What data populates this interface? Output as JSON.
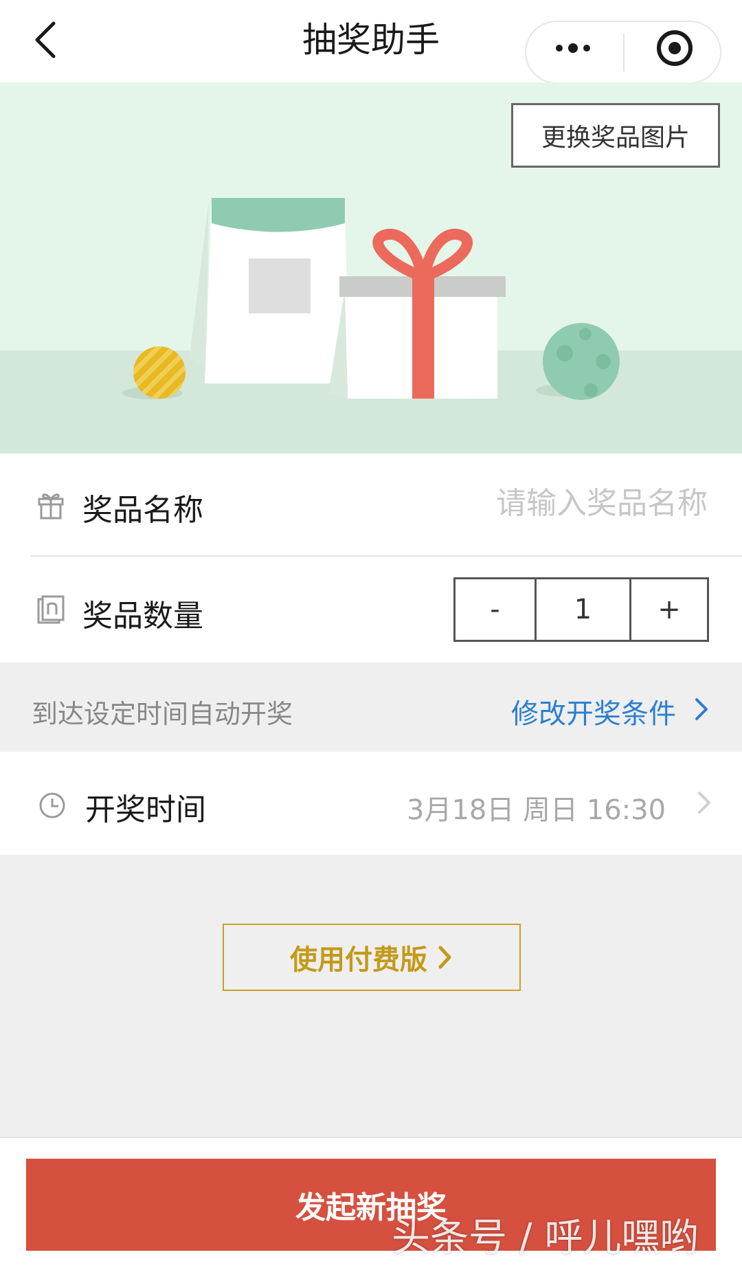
{
  "header": {
    "title": "抽奖助手",
    "back_icon": "chevron-left-icon",
    "more_icon": "more-dots-icon",
    "target_icon": "target-icon"
  },
  "banner": {
    "change_image_label": "更换奖品图片",
    "illustration": "prize-gift-illustration"
  },
  "form": {
    "prize_name": {
      "icon": "gift-icon",
      "label": "奖品名称",
      "placeholder": "请输入奖品名称",
      "value": ""
    },
    "prize_quantity": {
      "icon": "quantity-icon",
      "label": "奖品数量",
      "minus": "-",
      "value": "1",
      "plus": "+"
    }
  },
  "condition": {
    "description": "到达设定时间自动开奖",
    "link_label": "修改开奖条件",
    "link_icon": "chevron-right-icon"
  },
  "draw_time": {
    "icon": "clock-icon",
    "label": "开奖时间",
    "value": "3月18日 周日 16:30"
  },
  "paid_version": {
    "label": "使用付费版"
  },
  "footer": {
    "submit_label": "发起新抽奖"
  },
  "watermark": "头条号 / 呼儿嘿哟",
  "colors": {
    "accent_red": "#d5503f",
    "link_blue": "#2b7fd0",
    "gold": "#c39a1a",
    "banner_green": "#e4f5e9"
  }
}
